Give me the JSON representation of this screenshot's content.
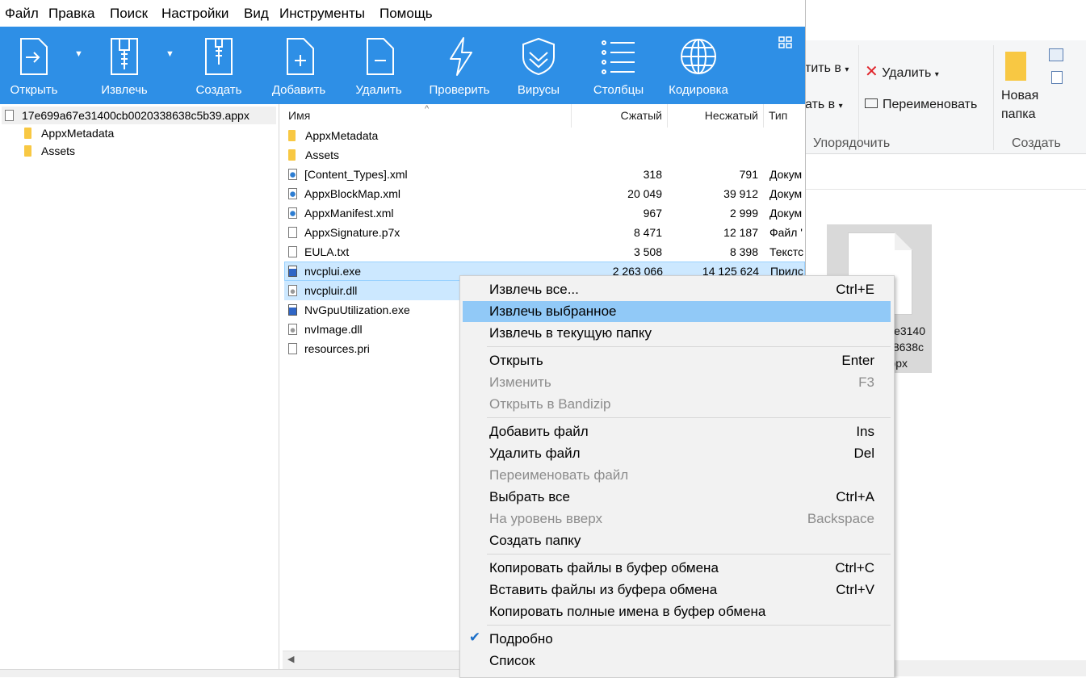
{
  "menubar": [
    "Файл",
    "Правка",
    "Поиск",
    "Настройки",
    "Вид",
    "Инструменты",
    "Помощь"
  ],
  "toolbar": {
    "buttons": [
      {
        "label": "Открыть",
        "icon": "open-icon"
      },
      {
        "label": "Извлечь",
        "icon": "extract-icon"
      },
      {
        "label": "Создать",
        "icon": "create-icon"
      },
      {
        "label": "Добавить",
        "icon": "add-file-icon"
      },
      {
        "label": "Удалить",
        "icon": "delete-file-icon"
      },
      {
        "label": "Проверить",
        "icon": "test-lightning-icon"
      },
      {
        "label": "Вирусы",
        "icon": "virus-shield-icon"
      },
      {
        "label": "Столбцы",
        "icon": "columns-list-icon"
      },
      {
        "label": "Кодировка",
        "icon": "globe-icon"
      }
    ],
    "accent": "#2e8fe6"
  },
  "tree": {
    "root": "17e699a67e31400cb0020338638c5b39.appx",
    "children": [
      "AppxMetadata",
      "Assets"
    ]
  },
  "list": {
    "columns": {
      "name": "Имя",
      "packed": "Сжатый",
      "unpacked": "Несжатый",
      "type": "Тип"
    },
    "rows": [
      {
        "name": "AppxMetadata",
        "packed": "",
        "unpacked": "",
        "type": "",
        "icon": "folder-icon"
      },
      {
        "name": "Assets",
        "packed": "",
        "unpacked": "",
        "type": "",
        "icon": "folder-icon"
      },
      {
        "name": "[Content_Types].xml",
        "packed": "318",
        "unpacked": "791",
        "type": "Докум",
        "icon": "xml-icon"
      },
      {
        "name": "AppxBlockMap.xml",
        "packed": "20 049",
        "unpacked": "39 912",
        "type": "Докум",
        "icon": "xml-icon"
      },
      {
        "name": "AppxManifest.xml",
        "packed": "967",
        "unpacked": "2 999",
        "type": "Докум",
        "icon": "xml-icon"
      },
      {
        "name": "AppxSignature.p7x",
        "packed": "8 471",
        "unpacked": "12 187",
        "type": "Файл '",
        "icon": "file-icon"
      },
      {
        "name": "EULA.txt",
        "packed": "3 508",
        "unpacked": "8 398",
        "type": "Текстс",
        "icon": "file-icon"
      },
      {
        "name": "nvcplui.exe",
        "packed": "2 263 066",
        "unpacked": "14 125 624",
        "type": "Прилс",
        "icon": "app-icon"
      },
      {
        "name": "nvcpluir.dll",
        "packed": "",
        "unpacked": "",
        "type": "",
        "icon": "dll-icon"
      },
      {
        "name": "NvGpuUtilization.exe",
        "packed": "",
        "unpacked": "",
        "type": "",
        "icon": "app-icon"
      },
      {
        "name": "nvImage.dll",
        "packed": "",
        "unpacked": "",
        "type": "",
        "icon": "dll-icon"
      },
      {
        "name": "resources.pri",
        "packed": "",
        "unpacked": "",
        "type": "",
        "icon": "file-icon"
      }
    ]
  },
  "context_menu": {
    "items": [
      {
        "label": "Извлечь все...",
        "shortcut": "Ctrl+E"
      },
      {
        "label": "Извлечь выбранное",
        "shortcut": "",
        "highlighted": true
      },
      {
        "label": "Извлечь в текущую папку",
        "shortcut": ""
      },
      {
        "label": "Открыть",
        "shortcut": "Enter"
      },
      {
        "label": "Изменить",
        "shortcut": "F3",
        "disabled": true
      },
      {
        "label": "Открыть в Bandizip",
        "shortcut": "",
        "disabled": true
      },
      {
        "label": "Добавить файл",
        "shortcut": "Ins"
      },
      {
        "label": "Удалить файл",
        "shortcut": "Del"
      },
      {
        "label": "Переименовать файл",
        "shortcut": "",
        "disabled": true
      },
      {
        "label": "Выбрать все",
        "shortcut": "Ctrl+A"
      },
      {
        "label": "На уровень вверх",
        "shortcut": "Backspace",
        "disabled": true
      },
      {
        "label": "Создать папку",
        "shortcut": ""
      },
      {
        "label": "Копировать файлы в буфер обмена",
        "shortcut": "Ctrl+C"
      },
      {
        "label": "Вставить файлы из буфера обмена",
        "shortcut": "Ctrl+V"
      },
      {
        "label": "Копировать полные имена в буфер обмена",
        "shortcut": ""
      },
      {
        "label": "Подробно",
        "shortcut": "",
        "checked": true
      },
      {
        "label": "Список",
        "shortcut": ""
      }
    ]
  },
  "explorer": {
    "move_to": "тить в",
    "copy_to": "ать в",
    "delete": "Удалить",
    "rename": "Переименовать",
    "new_folder_line1": "Новая",
    "new_folder_line2": "папка",
    "group_organize": "Упорядочить",
    "group_create": "Создать",
    "tile_name_l1": "e3140",
    "tile_name_l2": "8638c",
    "tile_name_l3": "ppx"
  }
}
